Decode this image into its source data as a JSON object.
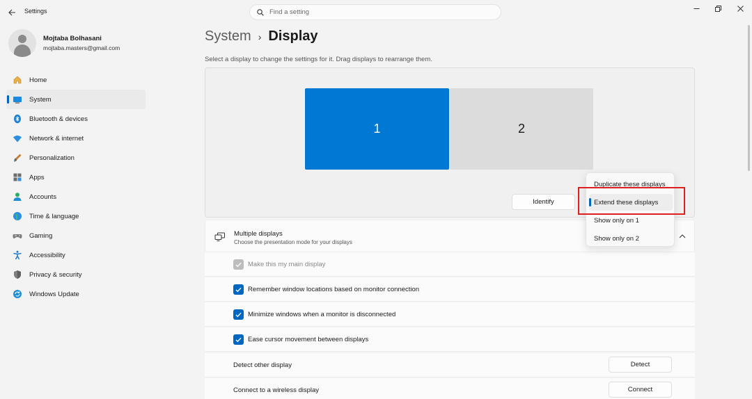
{
  "window": {
    "title": "Settings"
  },
  "search": {
    "placeholder": "Find a setting"
  },
  "profile": {
    "name": "Mojtaba Bolhasani",
    "email": "mojtaba.masters@gmail.com"
  },
  "sidebar": {
    "items": [
      {
        "label": "Home",
        "icon": "home-icon"
      },
      {
        "label": "System",
        "icon": "system-icon",
        "active": true
      },
      {
        "label": "Bluetooth & devices",
        "icon": "bluetooth-icon"
      },
      {
        "label": "Network & internet",
        "icon": "wifi-icon"
      },
      {
        "label": "Personalization",
        "icon": "brush-icon"
      },
      {
        "label": "Apps",
        "icon": "apps-icon"
      },
      {
        "label": "Accounts",
        "icon": "accounts-icon"
      },
      {
        "label": "Time & language",
        "icon": "globe-icon"
      },
      {
        "label": "Gaming",
        "icon": "gamepad-icon"
      },
      {
        "label": "Accessibility",
        "icon": "accessibility-icon"
      },
      {
        "label": "Privacy & security",
        "icon": "shield-icon"
      },
      {
        "label": "Windows Update",
        "icon": "update-icon"
      }
    ]
  },
  "breadcrumb": {
    "parent": "System",
    "current": "Display"
  },
  "instruction": "Select a display to change the settings for it. Drag displays to rearrange them.",
  "arrangement": {
    "monitors": [
      {
        "label": "1",
        "selected": true
      },
      {
        "label": "2",
        "selected": false
      }
    ],
    "identify_label": "Identify"
  },
  "multiple_displays": {
    "title": "Multiple displays",
    "subtitle": "Choose the presentation mode for your displays",
    "menu": {
      "options": [
        "Duplicate these displays",
        "Extend these displays",
        "Show only on 1",
        "Show only on 2"
      ],
      "selected": "Extend these displays"
    }
  },
  "settings": {
    "main_display": {
      "label": "Make this my main display",
      "checked": true,
      "disabled": true
    },
    "remember_windows": {
      "label": "Remember window locations based on monitor connection",
      "checked": true
    },
    "minimize_windows": {
      "label": "Minimize windows when a monitor is disconnected",
      "checked": true
    },
    "ease_cursor": {
      "label": "Ease cursor movement between displays",
      "checked": true
    },
    "detect": {
      "label": "Detect other display",
      "button": "Detect"
    },
    "wireless": {
      "label": "Connect to a wireless display",
      "button": "Connect"
    }
  },
  "colors": {
    "accent": "#0067c0",
    "monitor_selected": "#0078d4",
    "highlight_box": "#e01e1e"
  }
}
